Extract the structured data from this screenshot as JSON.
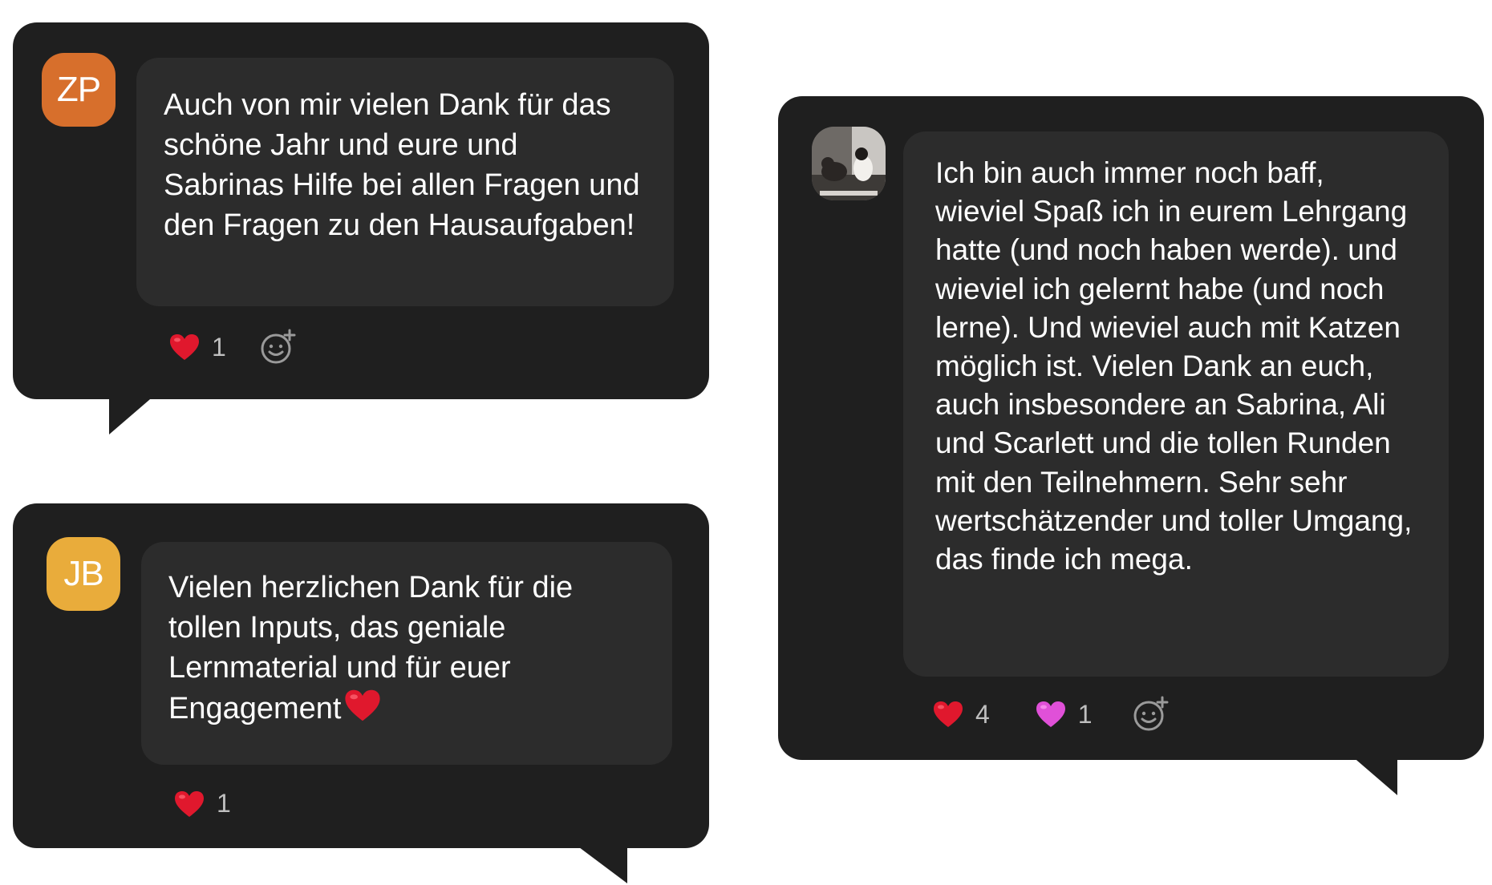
{
  "messages": [
    {
      "avatar": {
        "initials": "ZP",
        "color": "#d76f2c"
      },
      "text": "Auch von mir vielen Dank für das schöne Jahr und eure und Sabrinas Hilfe bei allen Fragen und den Fragen zu den Hausaufgaben!",
      "reactions": [
        {
          "emoji": "red-heart",
          "count": "1"
        }
      ]
    },
    {
      "avatar": {
        "initials": "JB",
        "color": "#e9ac3b"
      },
      "text": "Vielen herzlichen Dank für die tollen Inputs, das geniale Lernmaterial und für euer Engagement",
      "reactions": [
        {
          "emoji": "red-heart",
          "count": "1"
        }
      ]
    },
    {
      "avatar": {
        "type": "photo",
        "description": "cat-photo"
      },
      "text": "Ich bin auch immer noch baff, wieviel Spaß ich in eurem Lehrgang hatte (und noch haben werde). und wieviel ich gelernt habe (und noch lerne). Und wieviel auch mit Katzen möglich ist. Vielen Dank an euch, auch insbesondere an Sabrina, Ali und Scarlett und die tollen Runden mit den Teilnehmern. Sehr sehr wertschätzender und toller Umgang, das finde ich mega.",
      "reactions": [
        {
          "emoji": "red-heart",
          "count": "4"
        },
        {
          "emoji": "pink-heart",
          "count": "1"
        }
      ]
    }
  ],
  "colors": {
    "card_bg": "#1f1f1f",
    "bubble_bg": "#2c2c2c",
    "heart_red": "#e0182d",
    "heart_pink": "#e050d8",
    "text": "#ffffff",
    "count": "#bfbfbf"
  }
}
